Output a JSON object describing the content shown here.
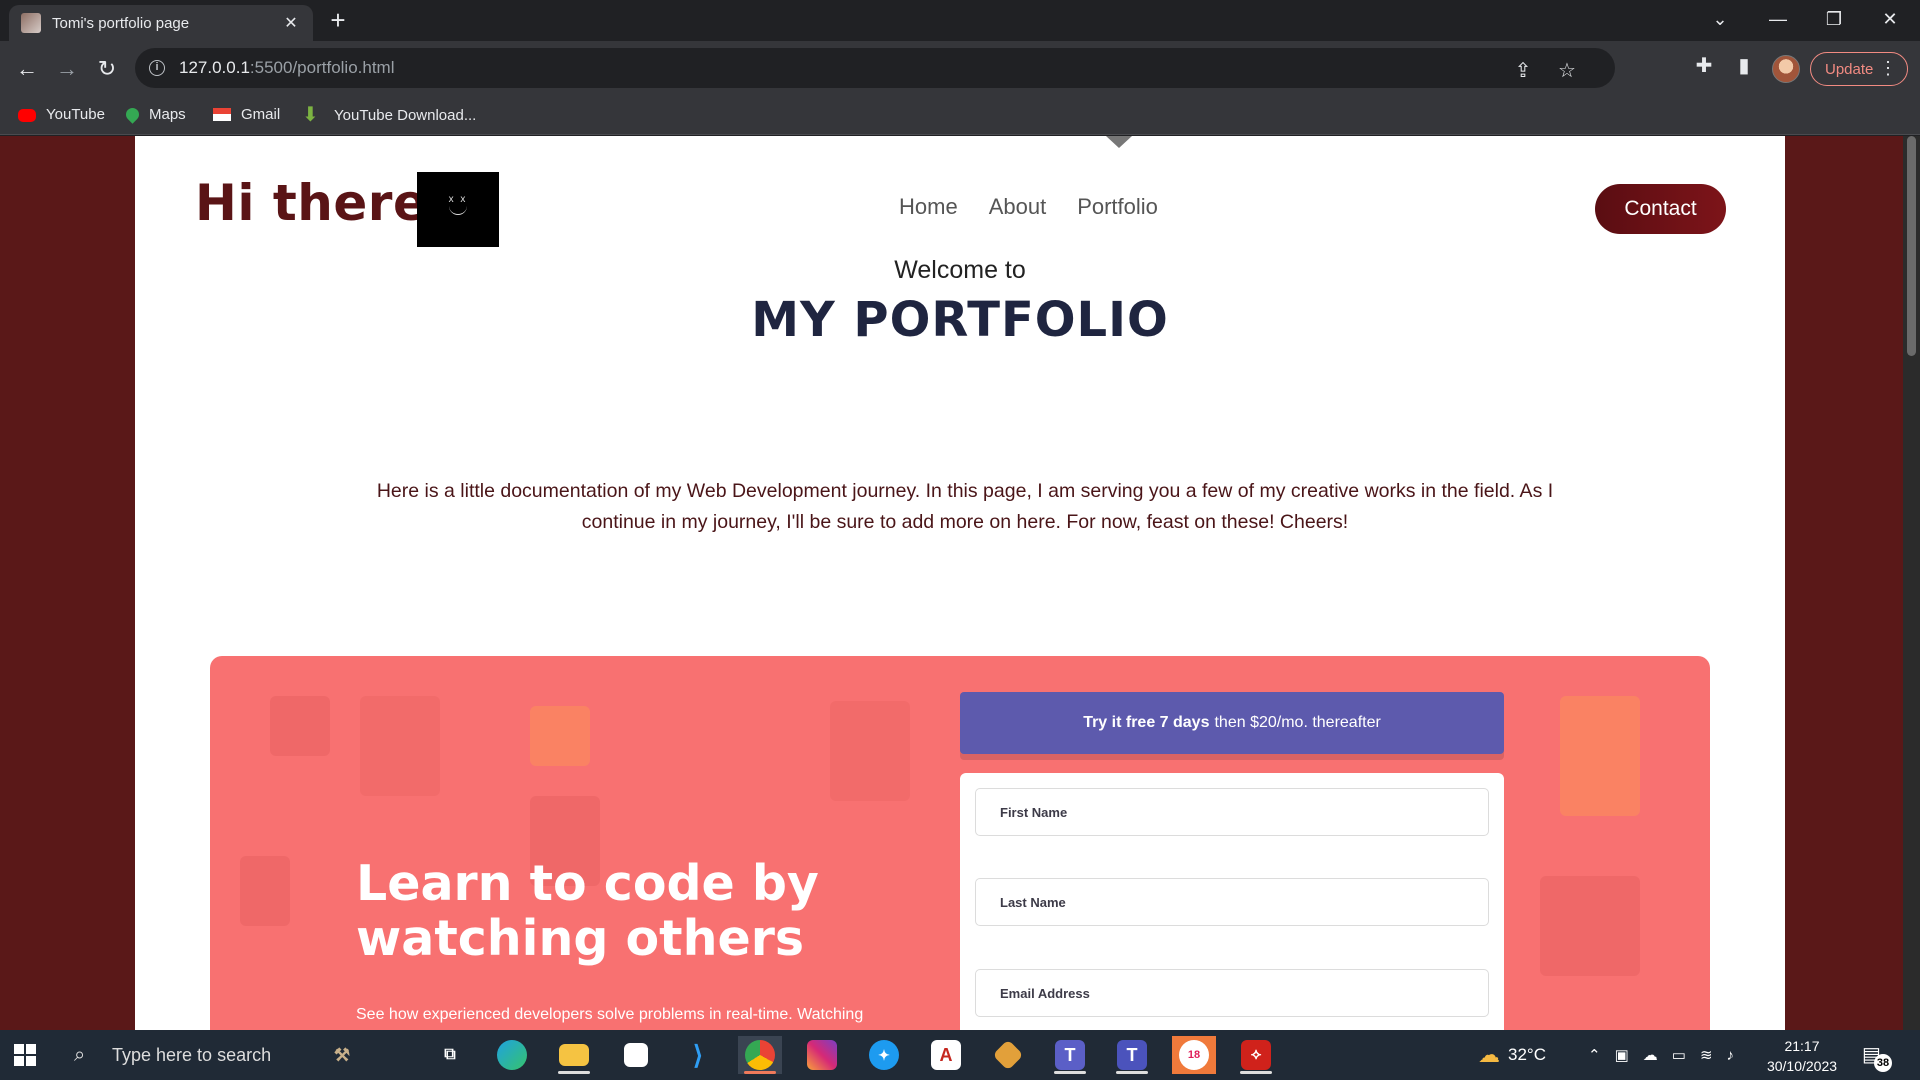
{
  "browser": {
    "tab_title": "Tomi's portfolio page",
    "tab_close": "✕",
    "new_tab": "+",
    "url_host": "127.0.0.1",
    "url_path": ":5500/portfolio.html",
    "update_label": "Update",
    "bookmarks": [
      "YouTube",
      "Maps",
      "Gmail",
      "YouTube Download..."
    ]
  },
  "header": {
    "logo_text": "Hi there!",
    "logo_face_eyes": "x x",
    "nav": [
      "Home",
      "About",
      "Portfolio"
    ],
    "contact_label": "Contact"
  },
  "hero": {
    "welcome": "Welcome to",
    "title": "MY PORTFOLIO",
    "intro": "Here is a little documentation of my Web Development journey. In this page, I am serving you a few of my creative works in the field. As I continue in my journey, I'll be sure to add more on here. For now, feast on these! Cheers!"
  },
  "promo": {
    "heading": "Learn to code by watching others",
    "subtext": "See how experienced developers solve problems in real-time. Watching",
    "trial_bold": "Try it free 7 days",
    "trial_rest": "then $20/mo. thereafter",
    "fields": [
      "First Name",
      "Last Name",
      "Email Address"
    ]
  },
  "taskbar": {
    "search_placeholder": "Type here to search",
    "temperature": "32°C",
    "time": "21:17",
    "date": "30/10/2023",
    "notification_count": "38",
    "slack_badge": "18"
  },
  "colors": {
    "brand_maroon": "#5a1416",
    "promo_bg": "#f87171",
    "trial_bg": "#5d5aad",
    "title_navy": "#1f2540"
  },
  "icons": [
    "back-icon",
    "forward-icon",
    "reload-icon",
    "info-icon",
    "share-icon",
    "star-icon",
    "extensions-icon",
    "sidepanel-icon",
    "menu-dots-icon"
  ]
}
